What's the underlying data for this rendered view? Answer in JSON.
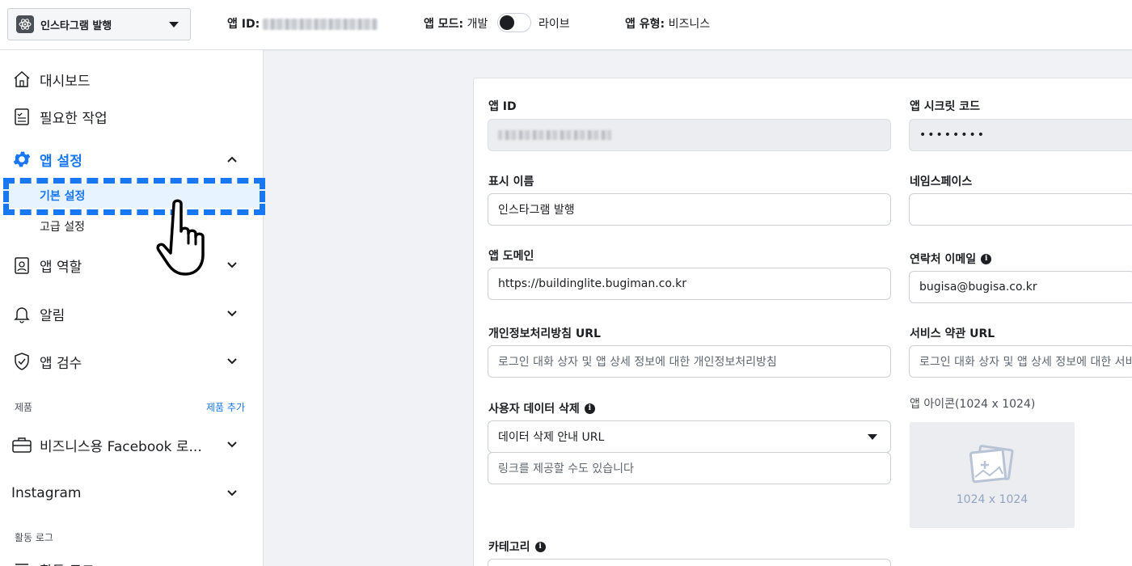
{
  "topbar": {
    "app_name": "인스타그램 발행",
    "app_id_label": "앱 ID:",
    "app_mode_label": "앱 모드:",
    "mode_dev": "개발",
    "mode_live": "라이브",
    "app_type_label": "앱 유형:",
    "app_type_value": "비즈니스"
  },
  "sidebar": {
    "dashboard": "대시보드",
    "required_actions": "필요한 작업",
    "app_settings": "앱 설정",
    "basic_settings": "기본 설정",
    "advanced_settings": "고급 설정",
    "app_roles": "앱 역할",
    "alerts": "알림",
    "app_review": "앱 검수",
    "products_label": "제품",
    "add_product": "제품 추가",
    "fb_login_business": "비즈니스용 Facebook 로...",
    "instagram": "Instagram",
    "activity_log_label": "활동 로그",
    "activity_log_item": "활동 로그"
  },
  "form": {
    "app_id_label": "앱 ID",
    "app_secret_label": "앱 시크릿 코드",
    "app_secret_value": "••••••••",
    "display_name_label": "표시 이름",
    "display_name_value": "인스타그램 발행",
    "namespace_label": "네임스페이스",
    "namespace_value": "",
    "app_domain_label": "앱 도메인",
    "app_domain_value": "https://buildinglite.bugiman.co.kr",
    "contact_email_label": "연락처 이메일",
    "contact_email_value": "bugisa@bugisa.co.kr",
    "privacy_url_label": "개인정보처리방침 URL",
    "privacy_url_placeholder": "로그인 대화 상자 및 앱 상세 정보에 대한 개인정보처리방침",
    "tos_url_label": "서비스 약관 URL",
    "tos_url_placeholder": "로그인 대화 상자 및 앱 상세 정보에 대한 서비스 약관",
    "data_deletion_label": "사용자 데이터 삭제",
    "data_deletion_select": "데이터 삭제 안내 URL",
    "data_deletion_placeholder": "링크를 제공할 수도 있습니다",
    "app_icon_label": "앱 아이콘(1024 x 1024)",
    "app_icon_size": "1024 x 1024",
    "category_label": "카테고리"
  },
  "colors": {
    "accent": "#1877f2",
    "selected_bg": "#e7f3ff"
  }
}
